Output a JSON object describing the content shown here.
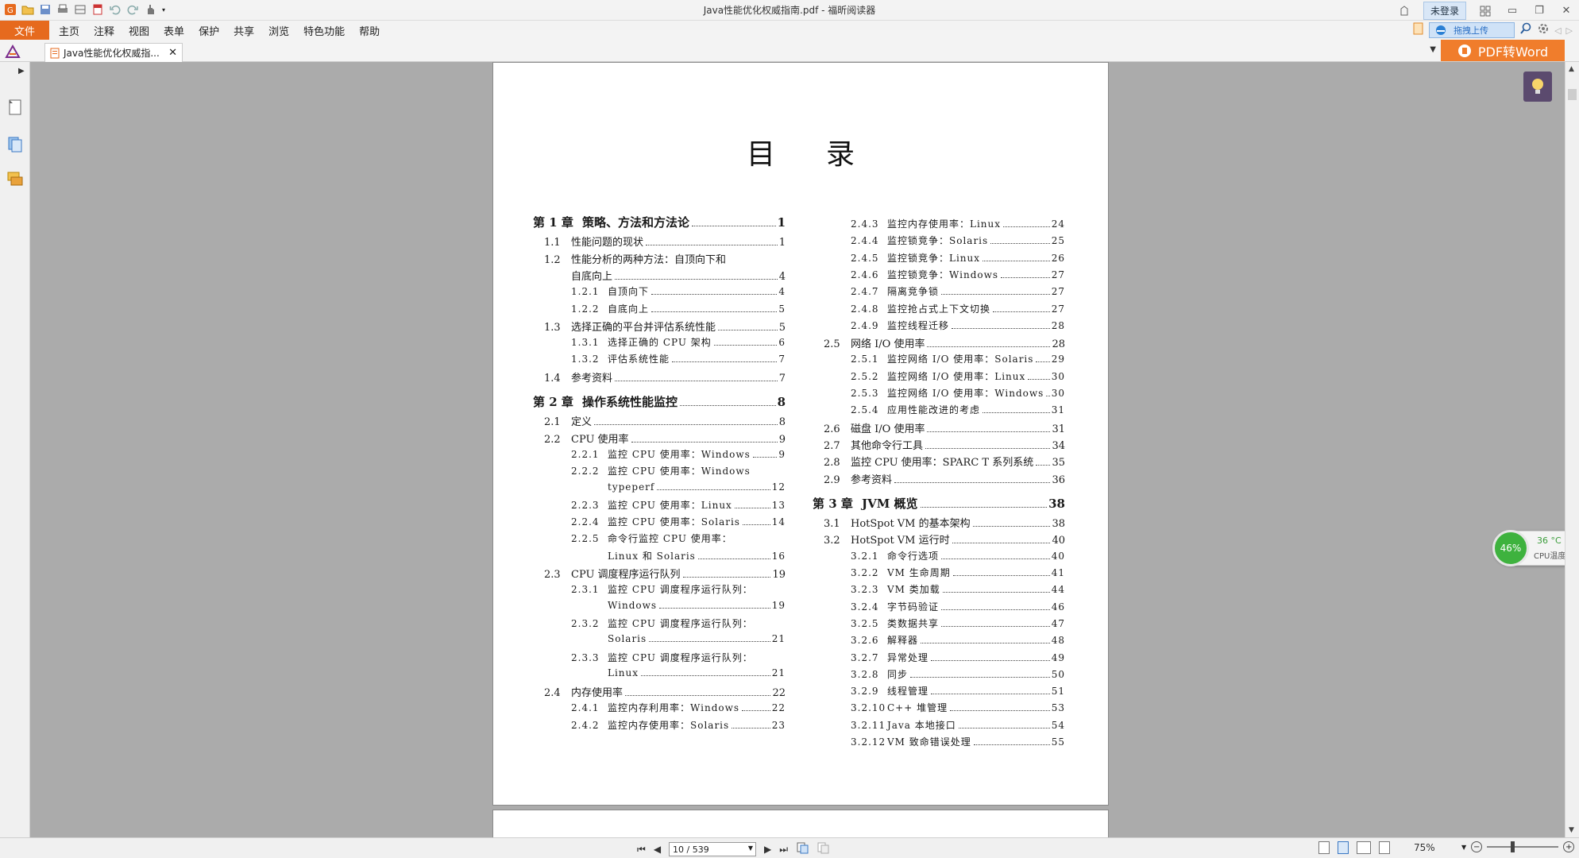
{
  "window": {
    "title": "Java性能优化权威指南.pdf - 福昕阅读器",
    "login_label": "未登录",
    "min": "▭",
    "restore": "❐",
    "close": "✕"
  },
  "menu": {
    "file": "文件",
    "items": [
      "主页",
      "注释",
      "视图",
      "表单",
      "保护",
      "共享",
      "浏览",
      "特色功能",
      "帮助"
    ],
    "upload_label": "拖拽上传"
  },
  "tabs": {
    "doc_tab_label": "Java性能优化权威指...",
    "close": "✕",
    "pdf2word_label": "PDF转Word"
  },
  "document": {
    "toc_title": "目录",
    "left_column": [
      {
        "level": 0,
        "num": "第 1 章",
        "text": "策略、方法和方法论",
        "page": "1"
      },
      {
        "level": 1,
        "num": "1.1",
        "text": "性能问题的现状",
        "page": "1"
      },
      {
        "level": 1,
        "num": "1.2",
        "text": "性能分析的两种方法：自顶向下和",
        "page": ""
      },
      {
        "level": 1,
        "num": "",
        "text": "自底向上",
        "page": "4"
      },
      {
        "level": 2,
        "num": "1.2.1",
        "text": "自顶向下",
        "page": "4"
      },
      {
        "level": 2,
        "num": "1.2.2",
        "text": "自底向上",
        "page": "5"
      },
      {
        "level": 1,
        "num": "1.3",
        "text": "选择正确的平台并评估系统性能",
        "page": "5"
      },
      {
        "level": 2,
        "num": "1.3.1",
        "text": "选择正确的 CPU 架构",
        "page": "6"
      },
      {
        "level": 2,
        "num": "1.3.2",
        "text": "评估系统性能",
        "page": "7"
      },
      {
        "level": 1,
        "num": "1.4",
        "text": "参考资料",
        "page": "7"
      },
      {
        "level": 0,
        "num": "第 2 章",
        "text": "操作系统性能监控",
        "page": "8"
      },
      {
        "level": 1,
        "num": "2.1",
        "text": "定义",
        "page": "8"
      },
      {
        "level": 1,
        "num": "2.2",
        "text": "CPU 使用率",
        "page": "9"
      },
      {
        "level": 2,
        "num": "2.2.1",
        "text": "监控 CPU 使用率：Windows",
        "page": "9"
      },
      {
        "level": 2,
        "num": "2.2.2",
        "text": "监控 CPU 使用率：Windows",
        "page": ""
      },
      {
        "level": 2,
        "num": "",
        "text": "typeperf",
        "page": "12"
      },
      {
        "level": 2,
        "num": "2.2.3",
        "text": "监控 CPU 使用率：Linux",
        "page": "13"
      },
      {
        "level": 2,
        "num": "2.2.4",
        "text": "监控 CPU 使用率：Solaris",
        "page": "14"
      },
      {
        "level": 2,
        "num": "2.2.5",
        "text": "命令行监控 CPU 使用率：",
        "page": ""
      },
      {
        "level": 2,
        "num": "",
        "text": "Linux 和 Solaris",
        "page": "16"
      },
      {
        "level": 1,
        "num": "2.3",
        "text": "CPU 调度程序运行队列",
        "page": "19"
      },
      {
        "level": 2,
        "num": "2.3.1",
        "text": "监控 CPU 调度程序运行队列：",
        "page": ""
      },
      {
        "level": 2,
        "num": "",
        "text": "Windows",
        "page": "19"
      },
      {
        "level": 2,
        "num": "2.3.2",
        "text": "监控 CPU 调度程序运行队列：",
        "page": ""
      },
      {
        "level": 2,
        "num": "",
        "text": "Solaris",
        "page": "21"
      },
      {
        "level": 2,
        "num": "2.3.3",
        "text": "监控 CPU 调度程序运行队列：",
        "page": ""
      },
      {
        "level": 2,
        "num": "",
        "text": "Linux",
        "page": "21"
      },
      {
        "level": 1,
        "num": "2.4",
        "text": "内存使用率",
        "page": "22"
      },
      {
        "level": 2,
        "num": "2.4.1",
        "text": "监控内存利用率：Windows",
        "page": "22"
      },
      {
        "level": 2,
        "num": "2.4.2",
        "text": "监控内存使用率：Solaris",
        "page": "23"
      }
    ],
    "right_column": [
      {
        "level": 2,
        "num": "2.4.3",
        "text": "监控内存使用率：Linux",
        "page": "24"
      },
      {
        "level": 2,
        "num": "2.4.4",
        "text": "监控锁竞争：Solaris",
        "page": "25"
      },
      {
        "level": 2,
        "num": "2.4.5",
        "text": "监控锁竞争：Linux",
        "page": "26"
      },
      {
        "level": 2,
        "num": "2.4.6",
        "text": "监控锁竞争：Windows",
        "page": "27"
      },
      {
        "level": 2,
        "num": "2.4.7",
        "text": "隔离竞争锁",
        "page": "27"
      },
      {
        "level": 2,
        "num": "2.4.8",
        "text": "监控抢占式上下文切换",
        "page": "27"
      },
      {
        "level": 2,
        "num": "2.4.9",
        "text": "监控线程迁移",
        "page": "28"
      },
      {
        "level": 1,
        "num": "2.5",
        "text": "网络 I/O 使用率",
        "page": "28"
      },
      {
        "level": 2,
        "num": "2.5.1",
        "text": "监控网络 I/O 使用率：Solaris",
        "page": "29"
      },
      {
        "level": 2,
        "num": "2.5.2",
        "text": "监控网络 I/O 使用率：Linux",
        "page": "30"
      },
      {
        "level": 2,
        "num": "2.5.3",
        "text": "监控网络 I/O 使用率：Windows",
        "page": "30"
      },
      {
        "level": 2,
        "num": "2.5.4",
        "text": "应用性能改进的考虑",
        "page": "31"
      },
      {
        "level": 1,
        "num": "2.6",
        "text": "磁盘 I/O 使用率",
        "page": "31"
      },
      {
        "level": 1,
        "num": "2.7",
        "text": "其他命令行工具",
        "page": "34"
      },
      {
        "level": 1,
        "num": "2.8",
        "text": "监控 CPU 使用率：SPARC T 系列系统",
        "page": "35"
      },
      {
        "level": 1,
        "num": "2.9",
        "text": "参考资料",
        "page": "36"
      },
      {
        "level": 0,
        "num": "第 3 章",
        "text": "JVM 概览",
        "page": "38"
      },
      {
        "level": 1,
        "num": "3.1",
        "text": "HotSpot VM 的基本架构",
        "page": "38"
      },
      {
        "level": 1,
        "num": "3.2",
        "text": "HotSpot VM 运行时",
        "page": "40"
      },
      {
        "level": 2,
        "num": "3.2.1",
        "text": "命令行选项",
        "page": "40"
      },
      {
        "level": 2,
        "num": "3.2.2",
        "text": "VM 生命周期",
        "page": "41"
      },
      {
        "level": 2,
        "num": "3.2.3",
        "text": "VM 类加载",
        "page": "44"
      },
      {
        "level": 2,
        "num": "3.2.4",
        "text": "字节码验证",
        "page": "46"
      },
      {
        "level": 2,
        "num": "3.2.5",
        "text": "类数据共享",
        "page": "47"
      },
      {
        "level": 2,
        "num": "3.2.6",
        "text": "解释器",
        "page": "48"
      },
      {
        "level": 2,
        "num": "3.2.7",
        "text": "异常处理",
        "page": "49"
      },
      {
        "level": 2,
        "num": "3.2.8",
        "text": "同步",
        "page": "50"
      },
      {
        "level": 2,
        "num": "3.2.9",
        "text": "线程管理",
        "page": "51"
      },
      {
        "level": 2,
        "num": "3.2.10",
        "text": "C++ 堆管理",
        "page": "53"
      },
      {
        "level": 2,
        "num": "3.2.11",
        "text": "Java 本地接口",
        "page": "54"
      },
      {
        "level": 2,
        "num": "3.2.12",
        "text": "VM 致命错误处理",
        "page": "55"
      }
    ]
  },
  "cpu_widget": {
    "usage": "46%",
    "temp": "36 °C",
    "label": "CPU温度",
    "plus": "+"
  },
  "status": {
    "page_indicator": "10 / 539",
    "zoom": "75%",
    "first": "⏮",
    "prev": "◀",
    "next": "▶",
    "last": "⏭"
  },
  "colors": {
    "accent_orange": "#e66a1e",
    "pdf2word_orange": "#f07d2c",
    "cpu_green": "#3eb23e"
  }
}
